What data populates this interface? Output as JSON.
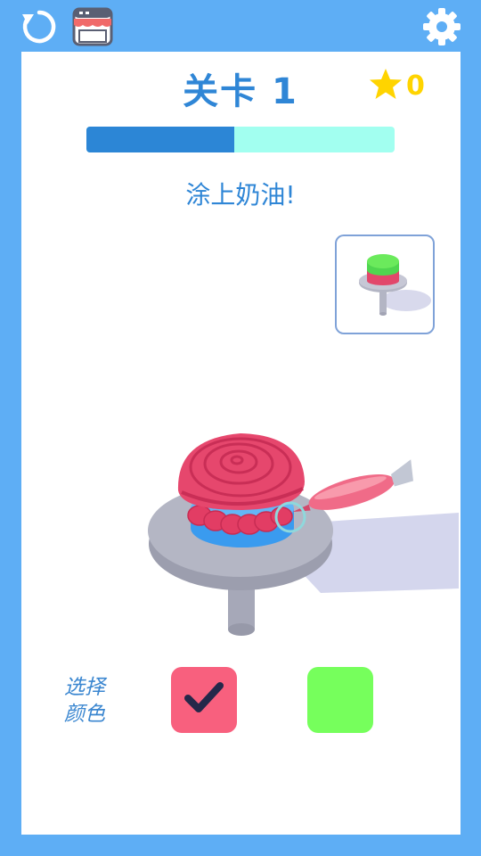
{
  "header": {
    "level_label": "关卡 1",
    "stars": "0",
    "progress_fraction": 0.48
  },
  "instruction": "涂上奶油!",
  "color_picker": {
    "label_line1": "选择",
    "label_line2": "颜色",
    "colors": [
      {
        "name": "pink",
        "hex": "#f8607e",
        "selected": true
      },
      {
        "name": "green",
        "hex": "#76ff5c",
        "selected": false
      }
    ]
  },
  "icons": {
    "restart": "restart-icon",
    "shop": "shop-icon",
    "settings": "gear-icon",
    "star": "star-icon",
    "check": "check-icon"
  },
  "colors": {
    "frame": "#5eaef5",
    "title": "#2f86d6",
    "progress_fill": "#2c86d6",
    "progress_track": "#a2fff0",
    "star": "#ffd400",
    "cream": "#e84a6c",
    "plate": "#a6a8b8"
  }
}
